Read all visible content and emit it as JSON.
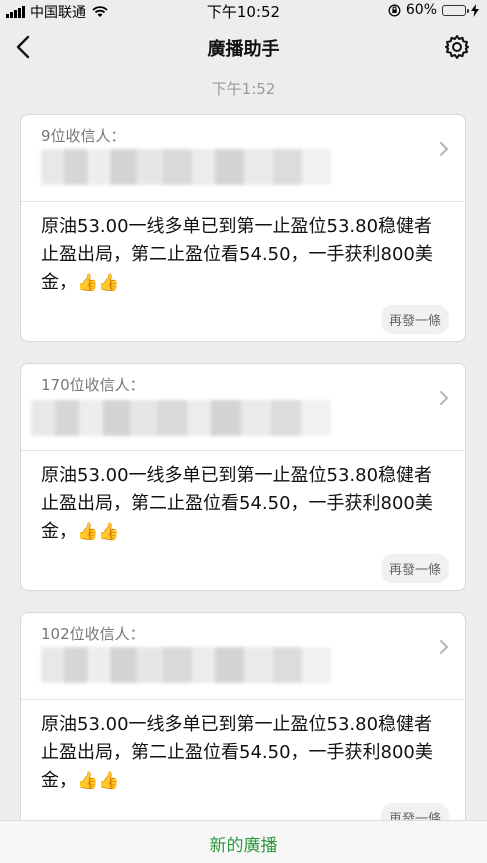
{
  "status_bar": {
    "carrier": "中国联通",
    "time": "下午10:52",
    "battery_percent": "60%",
    "battery_level": 0.6
  },
  "nav": {
    "title": "廣播助手"
  },
  "timestamp": "下午1:52",
  "cards": [
    {
      "recipients": "9位收信人：",
      "message": "原油53.00一线多单已到第一止盈位53.80稳健者止盈出局，第二止盈位看54.50，一手获利800美金，",
      "emoji": "👍👍",
      "resend_label": "再發一條"
    },
    {
      "recipients": "170位收信人：",
      "message": "原油53.00一线多单已到第一止盈位53.80稳健者止盈出局，第二止盈位看54.50，一手获利800美金，",
      "emoji": "👍👍",
      "resend_label": "再發一條"
    },
    {
      "recipients": "102位收信人：",
      "message": "原油53.00一线多单已到第一止盈位53.80稳健者止盈出局，第二止盈位看54.50，一手获利800美金，",
      "emoji": "👍👍",
      "resend_label": "再發一條"
    }
  ],
  "bottom": {
    "new_broadcast_label": "新的廣播"
  }
}
